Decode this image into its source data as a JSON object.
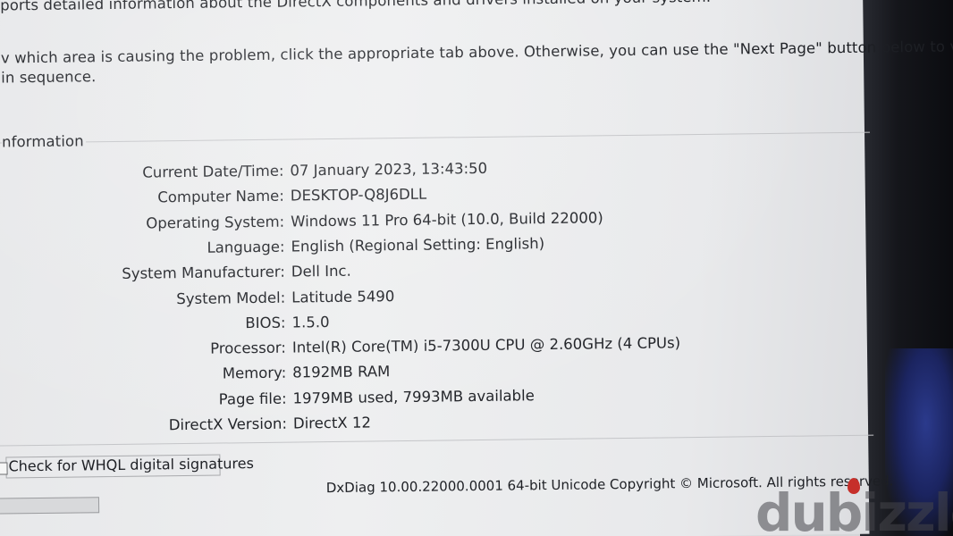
{
  "intro": {
    "line1": "ports detailed information about the DirectX components and drivers installed on your system.",
    "line2": "v which area is causing the problem, click the appropriate tab above. Otherwise, you can use the \"Next Page\" button below to visit",
    "line3": "in sequence."
  },
  "system_info": {
    "group_label": "nformation",
    "rows": [
      {
        "label": "Current Date/Time:",
        "value": "07 January 2023, 13:43:50"
      },
      {
        "label": "Computer Name:",
        "value": "DESKTOP-Q8J6DLL"
      },
      {
        "label": "Operating System:",
        "value": "Windows 11 Pro 64-bit (10.0, Build 22000)"
      },
      {
        "label": "Language:",
        "value": "English (Regional Setting: English)"
      },
      {
        "label": "System Manufacturer:",
        "value": "Dell Inc."
      },
      {
        "label": "System Model:",
        "value": "Latitude 5490"
      },
      {
        "label": "BIOS:",
        "value": "1.5.0"
      },
      {
        "label": "Processor:",
        "value": "Intel(R) Core(TM) i5-7300U CPU @ 2.60GHz (4 CPUs)"
      },
      {
        "label": "Memory:",
        "value": "8192MB RAM"
      },
      {
        "label": "Page file:",
        "value": "1979MB used, 7993MB available"
      },
      {
        "label": "DirectX Version:",
        "value": "DirectX 12"
      }
    ]
  },
  "whql_checkbox": {
    "label": "Check for WHQL digital signatures",
    "checked": false
  },
  "progress": {
    "fraction": 0
  },
  "footer": {
    "text": "DxDiag 10.00.22000.0001 64-bit Unicode  Copyright © Microsoft. All rights reserved."
  },
  "watermark": {
    "text": "dubizzle"
  }
}
